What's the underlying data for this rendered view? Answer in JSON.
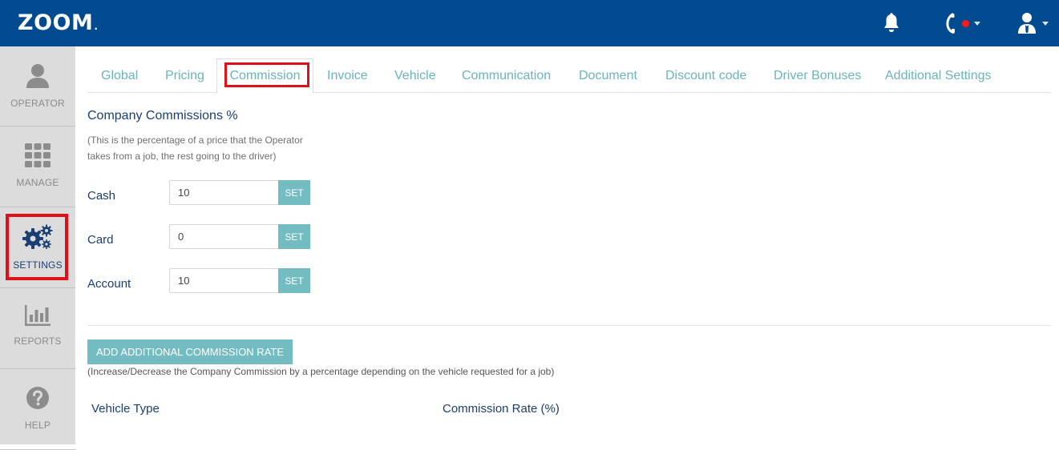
{
  "header": {
    "logo": "ZOOM",
    "logo_dot": ".",
    "colors": {
      "bar": "#004a8f",
      "notify_dot": "#ff1a1a"
    }
  },
  "sidebar": {
    "items": [
      {
        "label": "OPERATOR",
        "icon": "person-icon"
      },
      {
        "label": "MANAGE",
        "icon": "grid-icon"
      },
      {
        "label": "SETTINGS",
        "icon": "gears-icon",
        "active": true
      },
      {
        "label": "REPORTS",
        "icon": "bar-chart-icon"
      },
      {
        "label": "HELP",
        "icon": "question-icon"
      }
    ]
  },
  "tabs": [
    {
      "label": "Global"
    },
    {
      "label": "Pricing"
    },
    {
      "label": "Commission",
      "active": true
    },
    {
      "label": "Invoice"
    },
    {
      "label": "Vehicle"
    },
    {
      "label": "Communication"
    },
    {
      "label": "Document"
    },
    {
      "label": "Discount code"
    },
    {
      "label": "Driver Bonuses"
    },
    {
      "label": "Additional Settings"
    }
  ],
  "commission": {
    "title": "Company Commissions %",
    "description": "(This is the percentage of a price that the Operator takes from a job, the rest going to the driver)",
    "fields": [
      {
        "label": "Cash",
        "value": "10",
        "button": "SET"
      },
      {
        "label": "Card",
        "value": "0",
        "button": "SET"
      },
      {
        "label": "Account",
        "value": "10",
        "button": "SET"
      }
    ]
  },
  "additional": {
    "button": "ADD ADDITIONAL COMMISSION RATE",
    "description": "(Increase/Decrease the Company Commission by a percentage depending on the vehicle requested for a job)",
    "columns": [
      "Vehicle Type",
      "Commission Rate (%)"
    ]
  },
  "accent_color": "#73bcc1"
}
